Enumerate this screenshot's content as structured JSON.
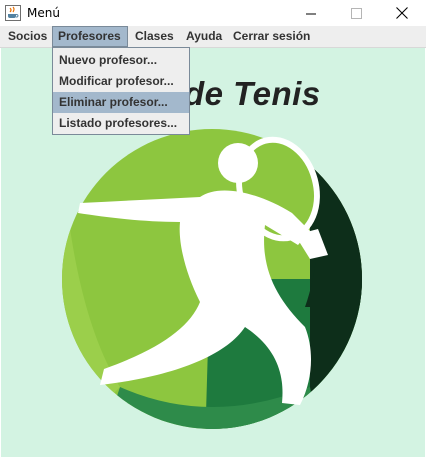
{
  "window": {
    "title": "Menú"
  },
  "menubar": {
    "items": [
      {
        "label": "Socios"
      },
      {
        "label": "Profesores"
      },
      {
        "label": "Clases"
      },
      {
        "label": "Ayuda"
      },
      {
        "label": "Cerrar sesión"
      }
    ],
    "active": "Profesores"
  },
  "dropdown": {
    "items": [
      {
        "label": "Nuevo profesor..."
      },
      {
        "label": "Modificar profesor..."
      },
      {
        "label": "Eliminar profesor..."
      },
      {
        "label": "Listado profesores..."
      }
    ],
    "highlighted": "Eliminar profesor..."
  },
  "main": {
    "heading": "de Tenis"
  },
  "colors": {
    "background": "#d3f3e2",
    "logo_light_green": "#8dc63f",
    "logo_dark": "#0d2e1a",
    "logo_mid_green": "#1e7a3e",
    "menu_highlight": "#a3b8cc"
  },
  "icons": [
    "java-cup-icon",
    "minimize-icon",
    "maximize-icon",
    "close-icon"
  ]
}
